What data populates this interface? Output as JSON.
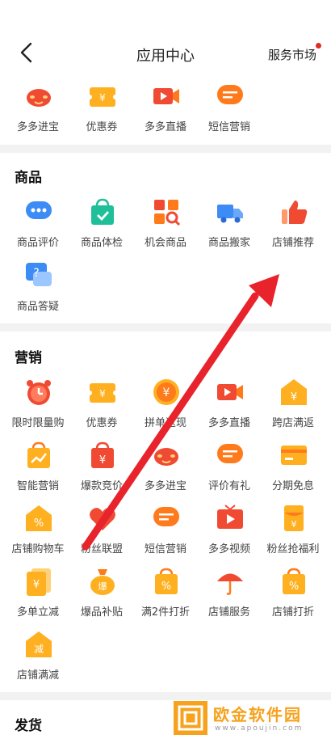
{
  "nav": {
    "title": "应用中心",
    "market_label": "服务市场"
  },
  "top_row": [
    {
      "label": "多多进宝",
      "icon": "piggy-face-icon"
    },
    {
      "label": "优惠券",
      "icon": "coupon-icon"
    },
    {
      "label": "多多直播",
      "icon": "video-play-icon"
    },
    {
      "label": "短信营销",
      "icon": "message-icon"
    }
  ],
  "goods": {
    "title": "商品",
    "items": [
      {
        "label": "商品评价",
        "icon": "chat-bubble-icon"
      },
      {
        "label": "商品体检",
        "icon": "shopping-bag-check-icon"
      },
      {
        "label": "机会商品",
        "icon": "grid-search-icon"
      },
      {
        "label": "商品搬家",
        "icon": "truck-icon"
      },
      {
        "label": "店铺推荐",
        "icon": "thumbs-up-icon"
      },
      {
        "label": "商品答疑",
        "icon": "question-bubble-icon"
      }
    ]
  },
  "marketing": {
    "title": "营销",
    "items": [
      {
        "label": "限时限量购",
        "icon": "alarm-clock-icon"
      },
      {
        "label": "优惠券",
        "icon": "coupon-icon"
      },
      {
        "label": "拼单返现",
        "icon": "coin-icon"
      },
      {
        "label": "多多直播",
        "icon": "video-play-icon"
      },
      {
        "label": "跨店满返",
        "icon": "house-yen-icon"
      },
      {
        "label": "智能营销",
        "icon": "bag-trend-icon"
      },
      {
        "label": "爆款竞价",
        "icon": "bag-yen-icon"
      },
      {
        "label": "多多进宝",
        "icon": "piggy-face-icon"
      },
      {
        "label": "评价有礼",
        "icon": "message-icon"
      },
      {
        "label": "分期免息",
        "icon": "card-icon"
      },
      {
        "label": "店铺购物车",
        "icon": "house-percent-icon"
      },
      {
        "label": "粉丝联盟",
        "icon": "heart-icon"
      },
      {
        "label": "短信营销",
        "icon": "message-icon"
      },
      {
        "label": "多多视频",
        "icon": "tv-play-icon"
      },
      {
        "label": "粉丝抢福利",
        "icon": "red-envelope-icon"
      },
      {
        "label": "多单立减",
        "icon": "yen-stack-icon"
      },
      {
        "label": "爆品补贴",
        "icon": "money-bag-icon"
      },
      {
        "label": "满2件打折",
        "icon": "bag-percent-icon"
      },
      {
        "label": "店铺服务",
        "icon": "umbrella-icon"
      },
      {
        "label": "店铺打折",
        "icon": "bag-percent-icon"
      },
      {
        "label": "店铺满减",
        "icon": "house-jian-icon"
      }
    ]
  },
  "shipping": {
    "title": "发货"
  },
  "watermark": {
    "title": "欧金软件园",
    "url": "www.apoujin.com"
  },
  "colors": {
    "orange": "#ff7a1a",
    "red": "#f04a33",
    "yellow": "#ffb020",
    "blue": "#3d8bf5",
    "teal": "#1fbf9a",
    "arrow": "#e8232c"
  }
}
